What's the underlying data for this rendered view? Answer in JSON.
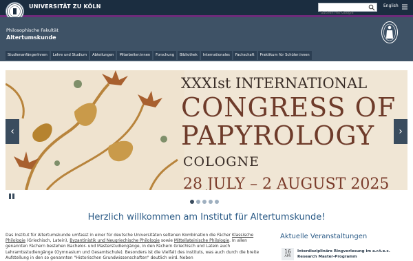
{
  "topbar": {
    "university_name": "UNIVERSITÄT ZU KÖLN",
    "search_placeholder": "Suchen mit Google",
    "language": "English",
    "logo_icon": "university-seal-icon",
    "search_icon": "search-icon",
    "menu_icon": "menu-icon"
  },
  "header": {
    "faculty": "Philosophische Fakultät",
    "institute": "Altertumskunde",
    "seal_icon": "faculty-seal-icon"
  },
  "nav": {
    "items": [
      {
        "label": "StudienanfängerInnen"
      },
      {
        "label": "Lehre und Studium"
      },
      {
        "label": "Abteilungen"
      },
      {
        "label": "Mitarbeiter:innen"
      },
      {
        "label": "Forschung"
      },
      {
        "label": "Bibliothek"
      },
      {
        "label": "Internationales"
      },
      {
        "label": "Fachschaft"
      },
      {
        "label": "Praktikum für Schüler:innen"
      }
    ]
  },
  "slider": {
    "line1": "XXXIst INTERNATIONAL",
    "line2": "CONGRESS OF",
    "line3": "PAPYROLOGY",
    "line4": "COLOGNE",
    "line5": "28 JULY – 2 AUGUST 2025",
    "prev_icon": "‹",
    "next_icon": "›",
    "dot_count": 5,
    "active_dot": 1
  },
  "welcome": {
    "title": "Herzlich willkommen am Institut für Altertumskunde!"
  },
  "intro": {
    "p1": "Das Institut für Altertumskunde umfasst in einer für deutsche Universitäten seltenen Kombination die Fächer",
    "link1": "Klassische Philologie",
    "p2": "(Griechisch, Latein),",
    "link2": "Byzantinistik und Neugriechische Philologie",
    "p3": "sowie",
    "link3": "Mittellateinische Philologie",
    "p4": ". In allen genannten Fächern bestehen Bachelor- und Masterstudiengänge, in den Fächern Griechisch und Latein auch Lehramtsstudiengänge (Gymnasium und Gesamtschule). Besonders ist die Vielfalt des Instituts, was auch durch die breite Aufstellung in den so genannten \"Historischen Grundwissenschaften\" deutlich wird. Neben"
  },
  "events": {
    "title": "Aktuelle Veranstaltungen",
    "items": [
      {
        "day": "16",
        "month": "APR",
        "text": "Interdisziplinäre Ringvorlesung im a.r.t.e.s. Research Master-Programm"
      }
    ]
  },
  "colors": {
    "topbar": "#1b2d40",
    "accent_purple": "#6e2b7a",
    "header": "#3e5266",
    "nav_item": "#2b3e52",
    "title_blue": "#2a5a86"
  }
}
